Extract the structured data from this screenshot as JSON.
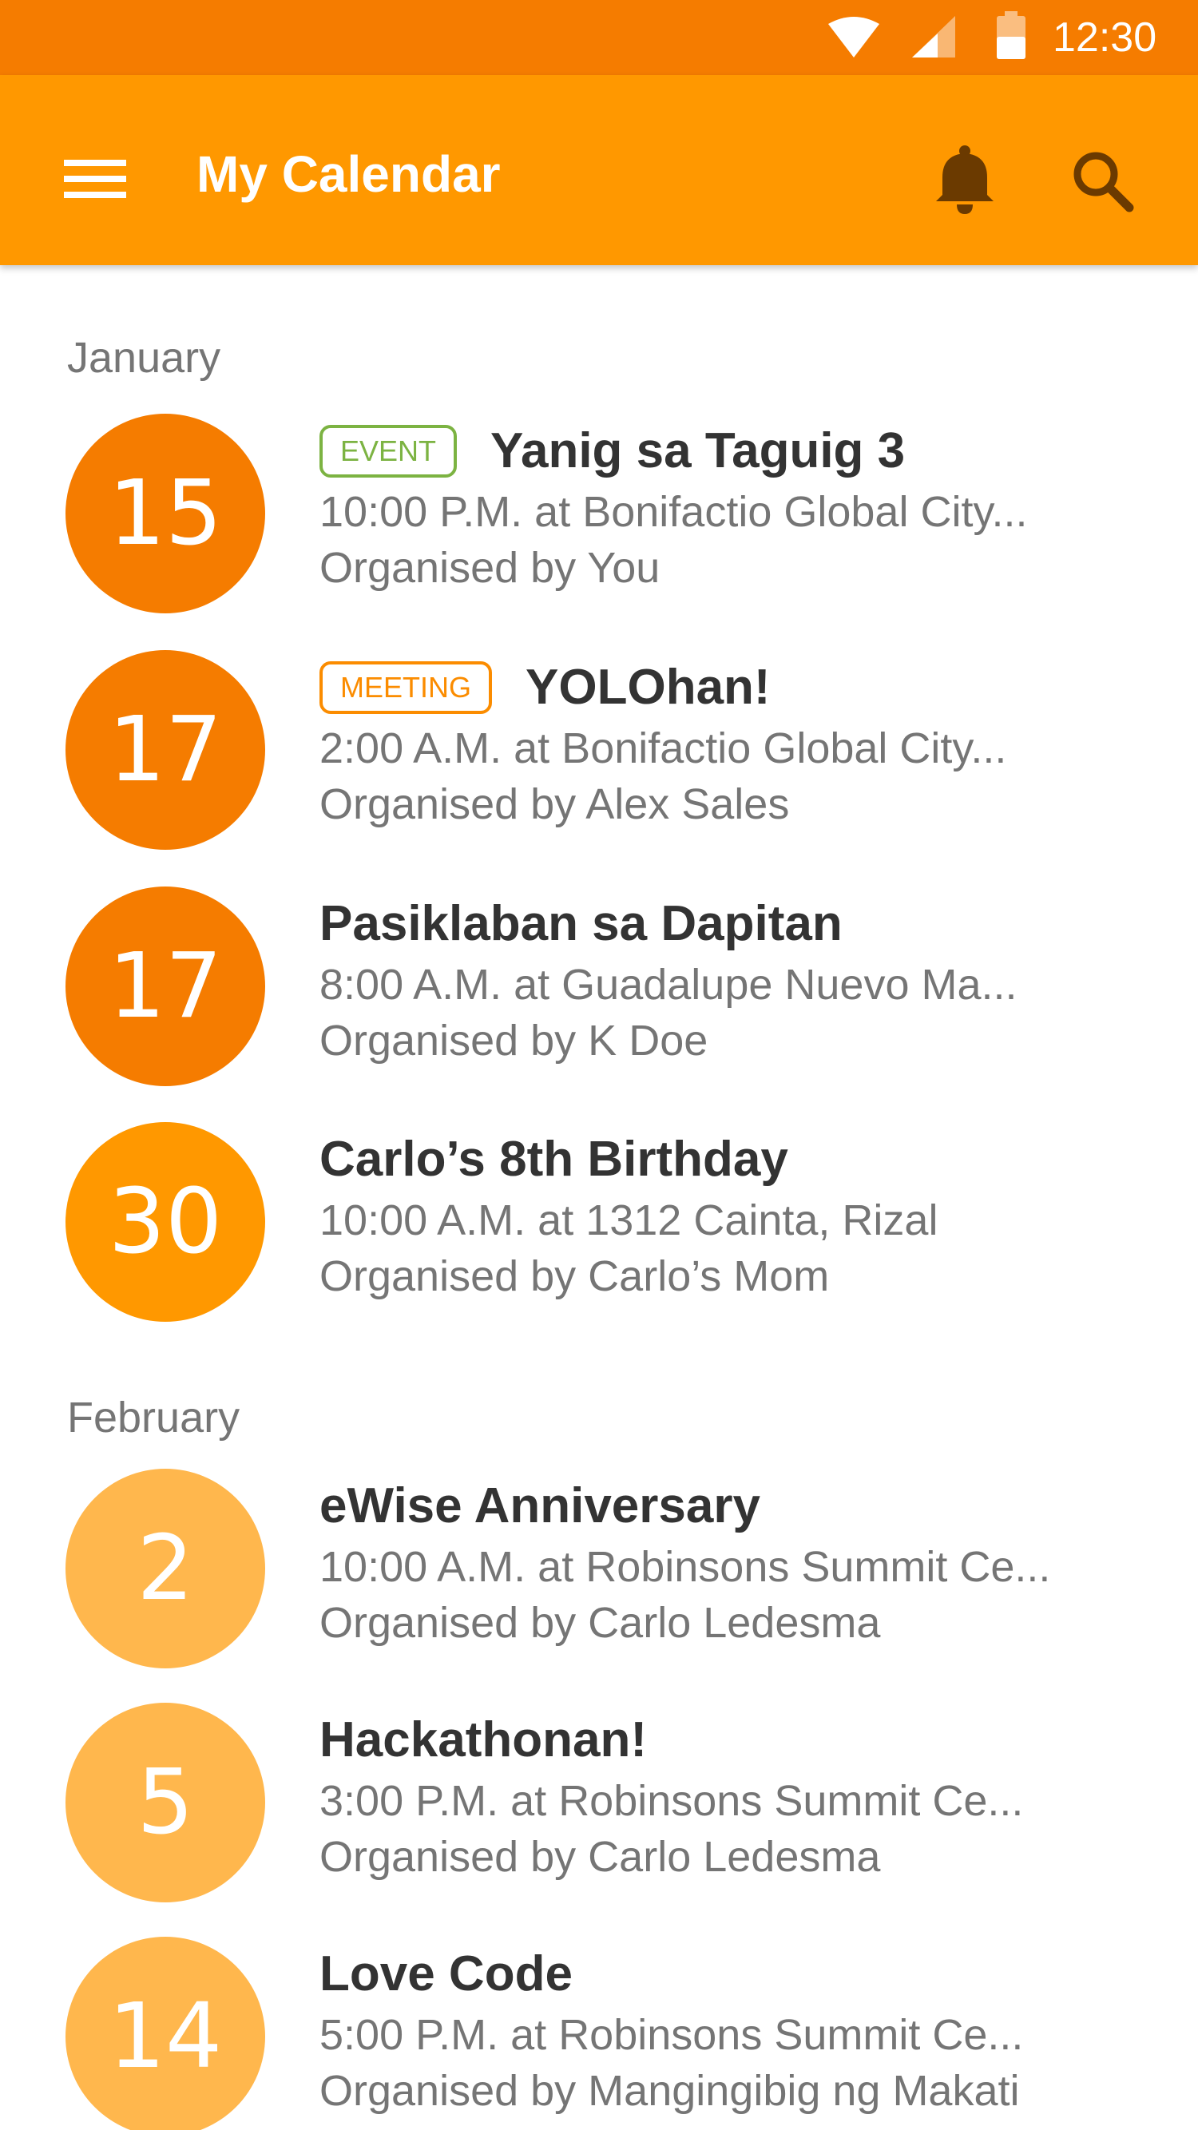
{
  "status_bar": {
    "time": "12:30",
    "background": "#F57C00"
  },
  "app_bar": {
    "title": "My Calendar",
    "background": "#FF9800",
    "icons": [
      "menu-icon",
      "bell-icon",
      "search-icon"
    ]
  },
  "months": [
    {
      "name": "January",
      "events": [
        {
          "day": "15",
          "tag": "EVENT",
          "tag_type": "event",
          "title": "Yanig sa Taguig 3",
          "when": "10:00 P.M. at Bonifactio Global City...",
          "organiser": "Organised by You",
          "circle_color": "#F57C00"
        },
        {
          "day": "17",
          "tag": "MEETING",
          "tag_type": "meeting",
          "title": "YOLOhan!",
          "when": "2:00 A.M. at Bonifactio Global City...",
          "organiser": "Organised by Alex Sales",
          "circle_color": "#F57C00"
        },
        {
          "day": "17",
          "tag": "",
          "tag_type": "",
          "title": "Pasiklaban sa Dapitan",
          "when": "8:00 A.M. at Guadalupe Nuevo Ma...",
          "organiser": "Organised by K Doe",
          "circle_color": "#F57C00"
        },
        {
          "day": "30",
          "tag": "",
          "tag_type": "",
          "title": "Carlo’s 8th Birthday",
          "when": "10:00 A.M. at 1312 Cainta, Rizal",
          "organiser": "Organised by Carlo’s Mom",
          "circle_color": "#FF9800"
        }
      ]
    },
    {
      "name": "February",
      "events": [
        {
          "day": "2",
          "tag": "",
          "tag_type": "",
          "title": "eWise Anniversary",
          "when": "10:00 A.M. at Robinsons Summit Ce...",
          "organiser": "Organised by Carlo Ledesma",
          "circle_color": "#FFB74D"
        },
        {
          "day": "5",
          "tag": "",
          "tag_type": "",
          "title": "Hackathonan!",
          "when": "3:00 P.M. at Robinsons Summit Ce...",
          "organiser": "Organised by Carlo Ledesma",
          "circle_color": "#FFB74D"
        },
        {
          "day": "14",
          "tag": "",
          "tag_type": "",
          "title": "Love Code",
          "when": "5:00 P.M. at Robinsons Summit Ce...",
          "organiser": "Organised by Mangingibig ng Makati",
          "circle_color": "#FFB74D"
        }
      ]
    }
  ]
}
